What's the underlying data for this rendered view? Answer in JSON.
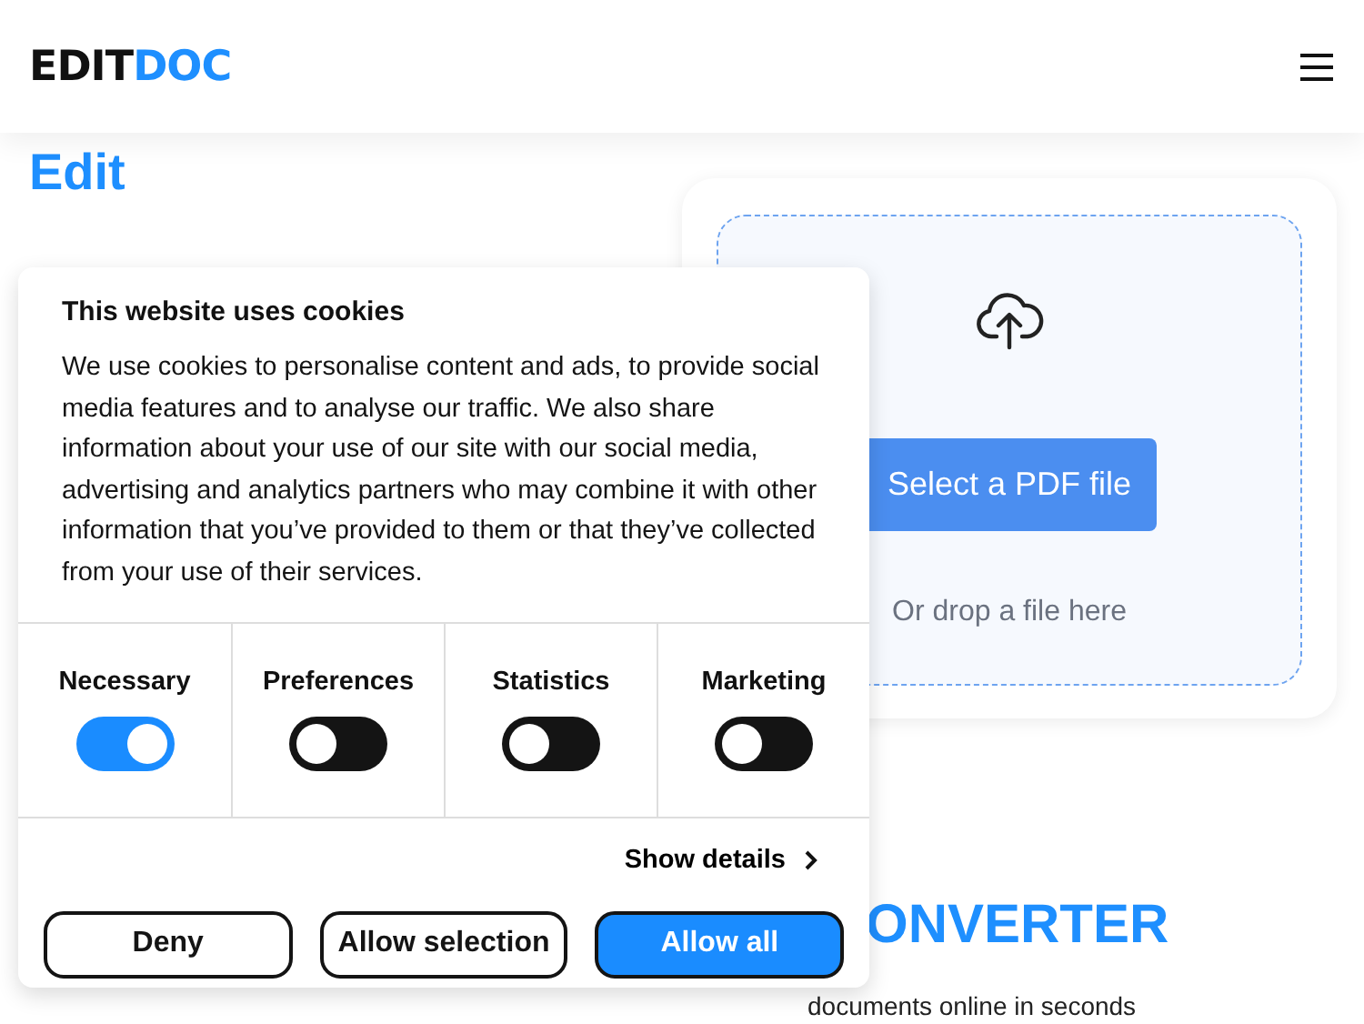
{
  "header": {
    "logo_dark": "EDIT",
    "logo_accent": "DOC"
  },
  "hero": {
    "heading": "Edit",
    "converter_heading": "ONVERTER",
    "subtitle": "documents online in seconds"
  },
  "upload": {
    "button": "Select a PDF file",
    "hint": "Or drop a file here"
  },
  "cookie_dialog": {
    "title": "This website uses cookies",
    "text": "We use cookies to personalise content and ads, to provide social media features and to analyse our traffic. We also share information about your use of our site with our social media, advertising and analytics partners who may combine it with other information that you’ve provided to them or that they’ve collected from your use of their services.",
    "categories": [
      {
        "label": "Necessary",
        "on": true
      },
      {
        "label": "Preferences",
        "on": false
      },
      {
        "label": "Statistics",
        "on": false
      },
      {
        "label": "Marketing",
        "on": false
      }
    ],
    "details_link": "Show details",
    "buttons": [
      {
        "label": "Deny",
        "kind": "outline"
      },
      {
        "label": "Allow selection",
        "kind": "outline"
      },
      {
        "label": "Allow all",
        "kind": "primary"
      }
    ]
  }
}
